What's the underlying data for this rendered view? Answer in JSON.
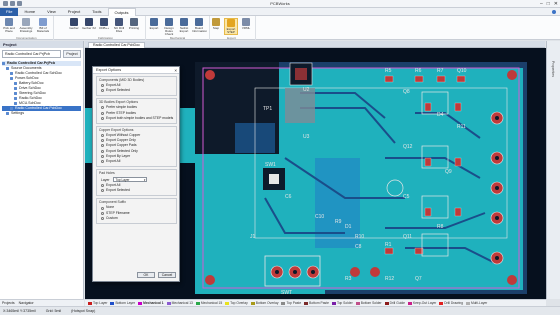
{
  "app": {
    "title": "PCBWorks",
    "window_controls": [
      "–",
      "□",
      "✕"
    ]
  },
  "menu": {
    "tabs": [
      "File",
      "Home",
      "View",
      "Project",
      "Tools",
      "Outputs"
    ],
    "active": "Outputs"
  },
  "ribbon": {
    "groups": [
      {
        "label": "Documentation",
        "buttons": [
          "Pick and Place",
          "Assembly Drawings",
          "Bill of Materials"
        ]
      },
      {
        "label": "Fabrication",
        "buttons": [
          "Gerber",
          "Gerber X2",
          "ODB++",
          "NC Drill Files",
          "Printing"
        ]
      },
      {
        "label": "Mechanical",
        "buttons": [
          "Export",
          "Design Rules Check",
          "Netlist Export",
          "Board Information"
        ]
      },
      {
        "label": "Export",
        "buttons": [
          "Step",
          "Export STEP",
          "VRML"
        ]
      }
    ],
    "selected_button": "Export STEP"
  },
  "project_panel": {
    "title": "Project",
    "project_combo": "Radio Controlled Car.PrjPcb",
    "project_button": "Project",
    "tree": [
      {
        "label": "Radio Controlled Car.PrjPcb",
        "level": 0,
        "root": true
      },
      {
        "label": "Source Documents",
        "level": 1
      },
      {
        "label": "Radio Controlled Car.SchDoc",
        "level": 2
      },
      {
        "label": "Power.SchDoc",
        "level": 2
      },
      {
        "label": "Battery.SchDoc",
        "level": 3
      },
      {
        "label": "Drive.SchDoc",
        "level": 3
      },
      {
        "label": "Steering.SchDoc",
        "level": 3
      },
      {
        "label": "Radio.SchDoc",
        "level": 3
      },
      {
        "label": "MCU.SchDoc",
        "level": 3
      },
      {
        "label": "Radio Controlled Car.PcbDoc",
        "level": 2,
        "selected": true
      },
      {
        "label": "Settings",
        "level": 1
      }
    ],
    "bottom_tabs": [
      "Projects",
      "Navigator"
    ]
  },
  "document_tab": "Radio Controlled Car.PcbDoc",
  "right_panel_label": "Properties",
  "dialog": {
    "title": "Export Options",
    "close": "×",
    "groups": [
      {
        "title": "Components (MID 3D Bodies)",
        "options": [
          {
            "label": "Export All",
            "type": "radio",
            "on": true
          },
          {
            "label": "Export Selected",
            "type": "radio",
            "on": false
          }
        ]
      },
      {
        "title": "3D Bodies Export Options",
        "options": [
          {
            "label": "Prefer simple bodies",
            "type": "radio",
            "on": false
          },
          {
            "label": "Prefer STEP bodies",
            "type": "radio",
            "on": false
          },
          {
            "label": "Export both simple bodies and STEP models",
            "type": "radio",
            "on": true
          }
        ]
      },
      {
        "title": "Copper Export Options",
        "options": [
          {
            "label": "Export Without Copper",
            "type": "radio",
            "on": false
          },
          {
            "label": "Export Copper Only",
            "type": "radio",
            "on": false
          },
          {
            "label": "Export Copper Pads",
            "type": "radio",
            "on": false
          },
          {
            "label": "Export Selected Only",
            "type": "radio",
            "on": false
          },
          {
            "label": "Export By Layer",
            "type": "radio",
            "on": false
          },
          {
            "label": "Export All",
            "type": "radio",
            "on": true
          }
        ]
      },
      {
        "title": "Pad Holes",
        "options": [
          {
            "label": "Export All",
            "type": "radio",
            "on": true
          },
          {
            "label": "Export Selected",
            "type": "radio",
            "on": false
          }
        ],
        "layer_label": "Layer",
        "layer_value": "Top Layer"
      },
      {
        "title": "Component Suffix",
        "options": [
          {
            "label": "None",
            "type": "radio",
            "on": true
          },
          {
            "label": "STEP Filename",
            "type": "radio",
            "on": false
          },
          {
            "label": "Custom",
            "type": "radio",
            "on": false
          }
        ]
      }
    ],
    "ok": "OK",
    "cancel": "Cancel"
  },
  "board": {
    "labels": [
      "R5",
      "R6",
      "R7",
      "Q10",
      "Q8",
      "D4",
      "R11",
      "Q12",
      "Q9",
      "C5",
      "R8",
      "Q11",
      "R1",
      "U2",
      "U3",
      "TP1",
      "SW1",
      "J1",
      "C6",
      "C10",
      "R9",
      "D1",
      "R10",
      "C8",
      "R12",
      "R3",
      "Q7",
      "SWT"
    ]
  },
  "layers": [
    {
      "name": "Top Layer",
      "color": "#c81e1e"
    },
    {
      "name": "Bottom Layer",
      "color": "#1f4fc9"
    },
    {
      "name": "Mechanical 1",
      "color": "#c600c6",
      "selected": true
    },
    {
      "name": "Mechanical 13",
      "color": "#8b5bd1"
    },
    {
      "name": "Mechanical 15",
      "color": "#2aa84a"
    },
    {
      "name": "Top Overlay",
      "color": "#e8e21e"
    },
    {
      "name": "Bottom Overlay",
      "color": "#a89a1a"
    },
    {
      "name": "Top Paste",
      "color": "#8a8a8a"
    },
    {
      "name": "Bottom Paste",
      "color": "#7a2a2a"
    },
    {
      "name": "Top Solder",
      "color": "#7a1ea8"
    },
    {
      "name": "Bottom Solder",
      "color": "#c0508a"
    },
    {
      "name": "Drill Guide",
      "color": "#8a1a1a"
    },
    {
      "name": "Keep-Out Layer",
      "color": "#c8208a"
    },
    {
      "name": "Drill Drawing",
      "color": "#e02020"
    },
    {
      "name": "Multi-Layer",
      "color": "#b0b0b0"
    }
  ],
  "status": {
    "coords": "X:3465mil Y:3735mil",
    "grid": "Grid: 5mil",
    "mode": "(Hotspot Snap)"
  },
  "colors": {
    "board": "#1b3f6a",
    "copper": "#1fb1bd",
    "pad": "#c03a3a",
    "silk": "#e6e6e6",
    "outline": "#d25ad2"
  }
}
